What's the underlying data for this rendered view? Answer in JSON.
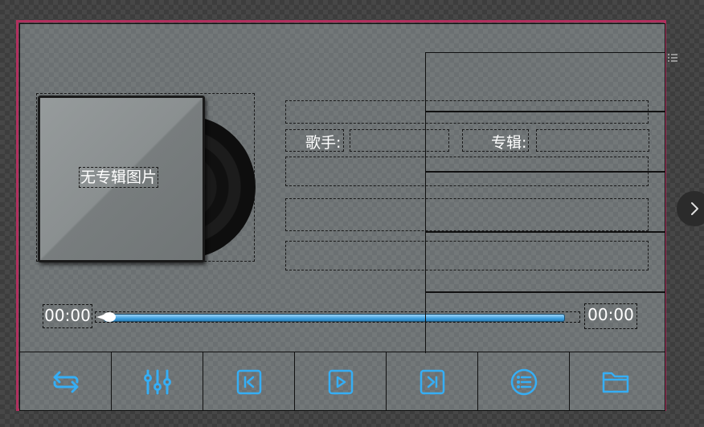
{
  "album": {
    "no_cover_text": "无专辑图片"
  },
  "song_info": {
    "singer_label": "歌手:",
    "album_label": "专辑:"
  },
  "progress": {
    "current_time": "00:00",
    "total_time": "00:00",
    "fraction": 0.0
  },
  "toolbar": {
    "buttons": [
      {
        "name": "loop-mode-button",
        "icon": "repeat-icon"
      },
      {
        "name": "equalizer-button",
        "icon": "equalizer-icon"
      },
      {
        "name": "previous-button",
        "icon": "skip-previous-icon"
      },
      {
        "name": "play-button",
        "icon": "play-icon"
      },
      {
        "name": "next-button",
        "icon": "skip-next-icon"
      },
      {
        "name": "playlist-button",
        "icon": "list-icon"
      },
      {
        "name": "open-folder-button",
        "icon": "folder-icon"
      }
    ]
  },
  "colors": {
    "frame": "#b0305e",
    "accent": "#35aef5",
    "panel": "#6b7072"
  }
}
